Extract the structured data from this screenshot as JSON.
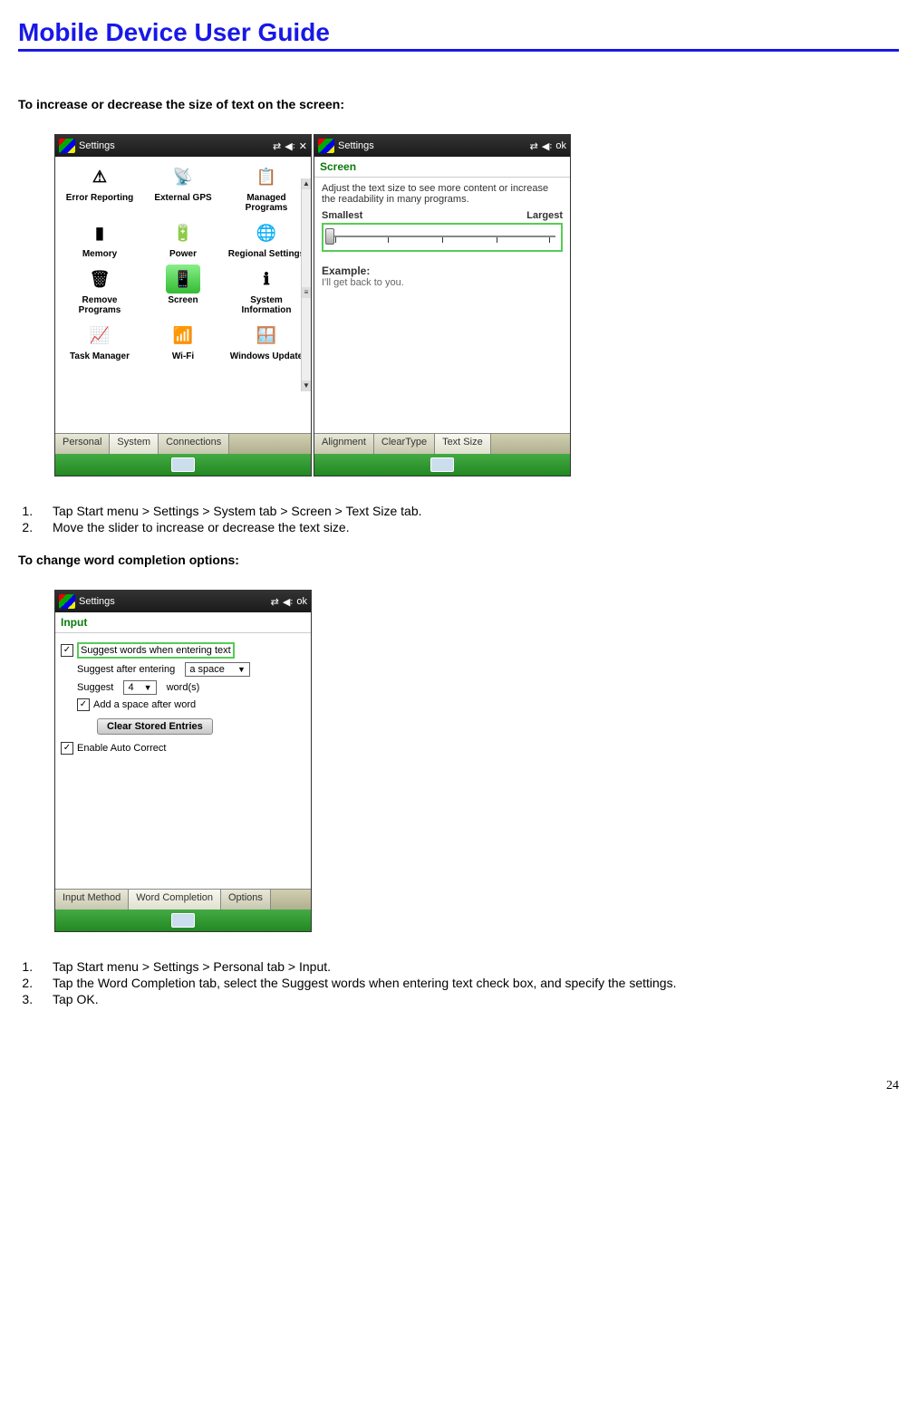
{
  "page": {
    "title": "Mobile Device User Guide",
    "number": "24"
  },
  "section1": {
    "heading": "To increase or decrease the size of text on the screen:",
    "steps": [
      "Tap Start menu > Settings > System tab > Screen > Text Size tab.",
      "Move the slider to increase or decrease the text size."
    ]
  },
  "section2": {
    "heading": "To change word completion options:",
    "steps": [
      "Tap Start menu > Settings > Personal tab > Input.",
      "Tap the Word Completion tab, select the Suggest words when entering text check box, and specify the settings.",
      "Tap OK."
    ]
  },
  "shot1": {
    "header": "Settings",
    "close": "✕",
    "items": [
      {
        "label": "Error Reporting",
        "icon": "⚠"
      },
      {
        "label": "External GPS",
        "icon": "📡"
      },
      {
        "label": "Managed Programs",
        "icon": "📋"
      },
      {
        "label": "Memory",
        "icon": "▮"
      },
      {
        "label": "Power",
        "icon": "🔋"
      },
      {
        "label": "Regional Settings",
        "icon": "🌐"
      },
      {
        "label": "Remove Programs",
        "icon": "🗑"
      },
      {
        "label": "Screen",
        "icon": "📱",
        "selected": true
      },
      {
        "label": "System Information",
        "icon": "ℹ"
      },
      {
        "label": "Task Manager",
        "icon": "📈"
      },
      {
        "label": "Wi-Fi",
        "icon": "📶"
      },
      {
        "label": "Windows Update",
        "icon": "🪟"
      }
    ],
    "tabs": [
      "Personal",
      "System",
      "Connections"
    ],
    "active_tab": 1
  },
  "shot2": {
    "header": "Settings",
    "ok": "ok",
    "screen_title": "Screen",
    "desc": "Adjust the text size to see more content or increase the readability in many programs.",
    "smallest": "Smallest",
    "largest": "Largest",
    "example_label": "Example:",
    "example_text": "I'll get back to you.",
    "tabs": [
      "Alignment",
      "ClearType",
      "Text Size"
    ],
    "active_tab": 2
  },
  "shot3": {
    "header": "Settings",
    "ok": "ok",
    "screen_title": "Input",
    "opt_suggest": "Suggest words when entering text",
    "line_after": "Suggest after entering",
    "after_value": "a space",
    "line_suggest": "Suggest",
    "words_count": "4",
    "words_label": "word(s)",
    "opt_add_space": "Add a space after word",
    "btn_clear": "Clear Stored Entries",
    "opt_autocorrect": "Enable Auto Correct",
    "tabs": [
      "Input Method",
      "Word Completion",
      "Options"
    ],
    "active_tab": 1
  }
}
